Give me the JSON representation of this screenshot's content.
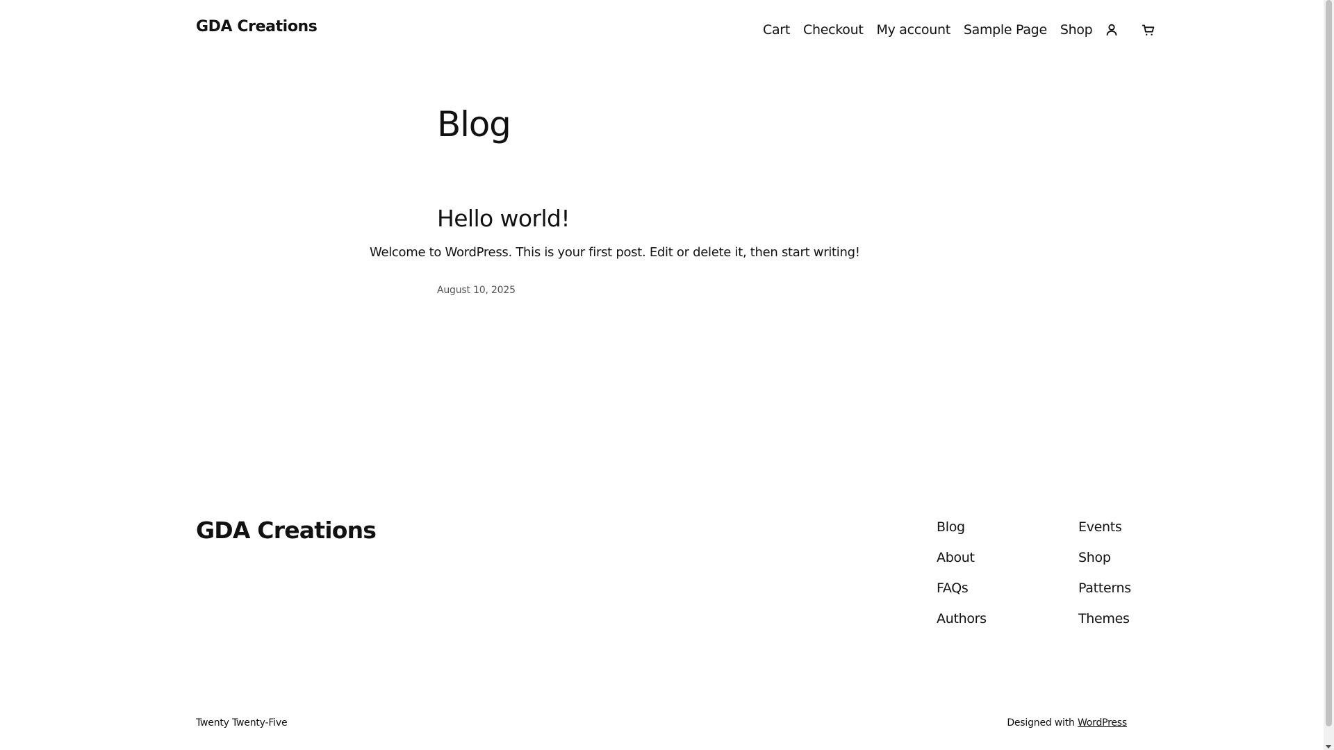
{
  "header": {
    "site_title": "GDA Creations",
    "nav": {
      "cart": "Cart",
      "checkout": "Checkout",
      "my_account": "My account",
      "sample_page": "Sample Page",
      "shop": "Shop"
    },
    "icons": {
      "account": "user-icon",
      "cart": "shopping-cart-icon"
    }
  },
  "main": {
    "page_title": "Blog",
    "post": {
      "title": "Hello world!",
      "excerpt": "Welcome to WordPress. This is your first post. Edit or delete it, then start writing!",
      "date": "August 10, 2025"
    }
  },
  "footer": {
    "site_title": "GDA Creations",
    "col1": [
      "Blog",
      "About",
      "FAQs",
      "Authors"
    ],
    "col2": [
      "Events",
      "Shop",
      "Patterns",
      "Themes"
    ],
    "theme_name": "Twenty Twenty-Five",
    "credit_prefix": "Designed with",
    "credit_link": "WordPress"
  }
}
